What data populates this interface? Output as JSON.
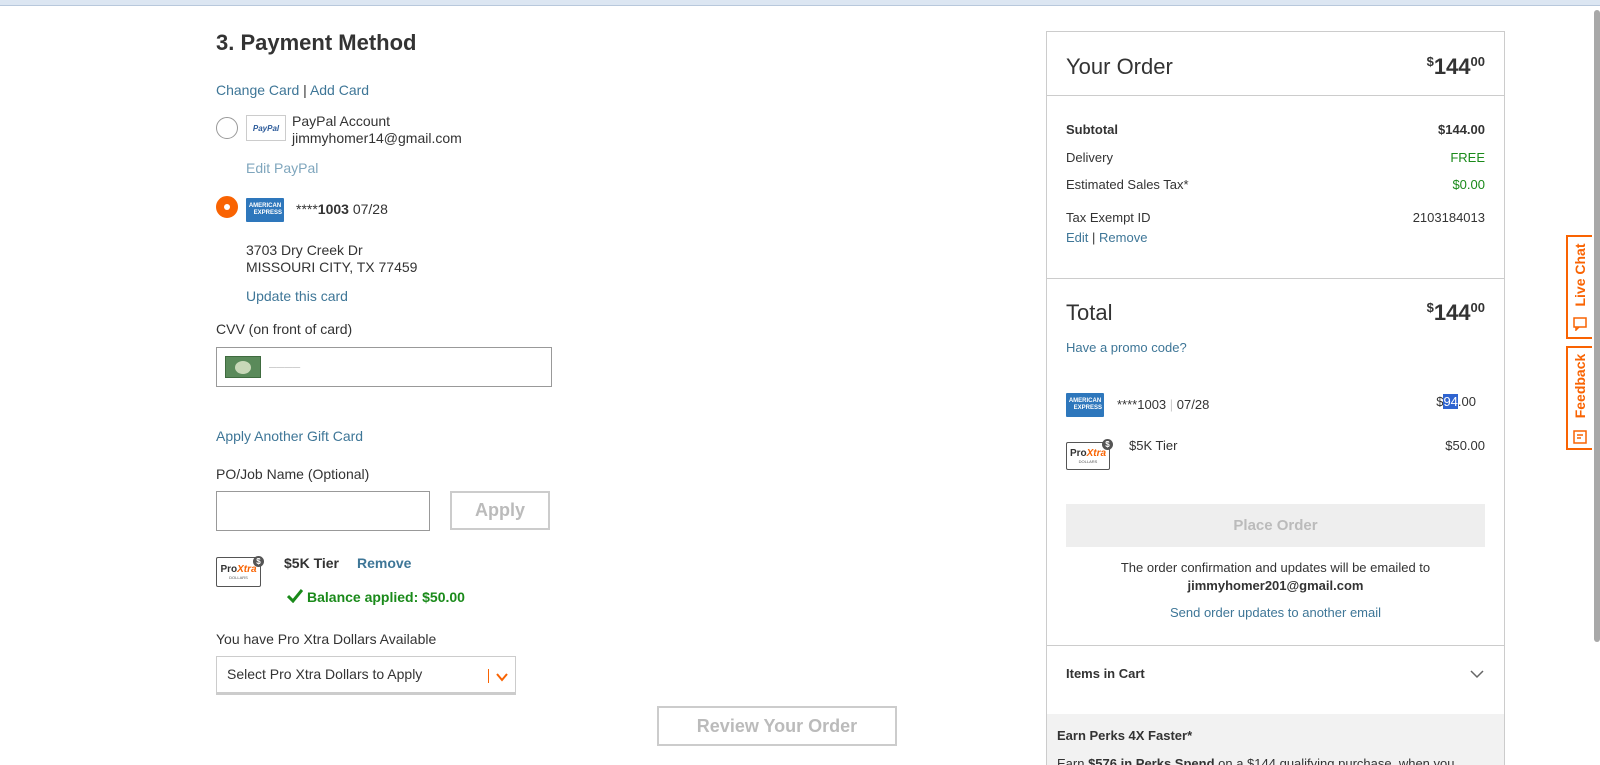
{
  "section": {
    "title": "3. Payment Method",
    "change_card": "Change Card",
    "sep": "|",
    "add_card": "Add Card"
  },
  "paypal": {
    "logo": "PayPal",
    "label": "PayPal Account",
    "email": "jimmyhomer14@gmail.com",
    "edit": "Edit PayPal"
  },
  "card": {
    "amex_line1": "AMERICAN",
    "amex_line2": "EXPRESS",
    "mask": "****",
    "last4": "1003",
    "exp": "07/28",
    "address1": "3703 Dry Creek Dr",
    "address2": "MISSOURI CITY, TX 77459",
    "update": "Update this card"
  },
  "cvv": {
    "label": "CVV (on front of card)",
    "placeholder": "––––"
  },
  "gift": {
    "apply_another": "Apply Another Gift Card"
  },
  "po": {
    "label": "PO/Job Name (Optional)",
    "value": "",
    "apply": "Apply"
  },
  "pro_xtra": {
    "logo_pro": "Pro",
    "logo_xtra": "Xtra",
    "logo_dollars": "DOLLARS",
    "coin": "$",
    "tier": "$5K Tier",
    "remove": "Remove",
    "balance": "Balance applied: $50.00",
    "available_label": "You have Pro Xtra Dollars Available",
    "select_placeholder": "Select Pro Xtra Dollars to Apply"
  },
  "review_button": "Review Your Order",
  "order": {
    "title": "Your Order",
    "currency": "$",
    "total_whole": "144",
    "total_cents": "00",
    "subtotal_label": "Subtotal",
    "subtotal_value": "$144.00",
    "delivery_label": "Delivery",
    "delivery_value": "FREE",
    "tax_label": "Estimated Sales Tax*",
    "tax_value": "$0.00",
    "tax_exempt_label": "Tax Exempt ID",
    "tax_exempt_value": "2103184013",
    "edit": "Edit",
    "sep": "|",
    "remove": "Remove",
    "total_label": "Total",
    "promo": "Have a promo code?",
    "pay_card_mask": "****1003",
    "pay_card_sep": "|",
    "pay_card_exp": "07/28",
    "pay_card_amount_prefix": "$",
    "pay_card_amount_selected": "94",
    "pay_card_amount_suffix": ".00",
    "pay_tier_label": "$5K Tier",
    "pay_tier_amount": "$50.00",
    "place_order": "Place Order",
    "confirm_text": "The order confirmation and updates will be emailed to",
    "confirm_email": "jimmyhomer201@gmail.com",
    "send_updates": "Send order updates to another email",
    "items_in_cart": "Items in Cart",
    "perks_title": "Earn Perks 4X Faster*",
    "perks_text_1": "Earn ",
    "perks_bold": "$576 in Perks Spend",
    "perks_text_2": " on a $144 qualifying purchase, when you"
  },
  "side": {
    "live_chat": "Live Chat",
    "feedback": "Feedback"
  },
  "colors": {
    "accent": "#f96302",
    "link": "#3e7697",
    "success": "#1a8a1a",
    "amex": "#2e77bc"
  }
}
